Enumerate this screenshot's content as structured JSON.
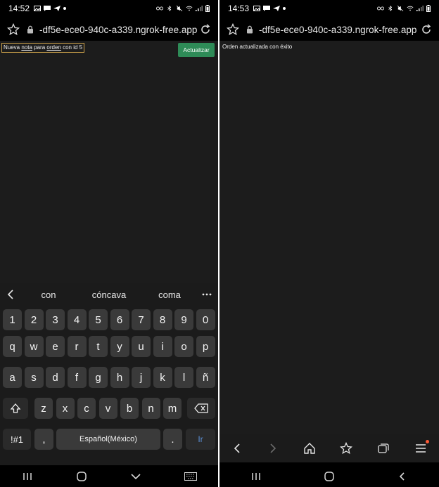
{
  "left": {
    "status": {
      "time": "14:52"
    },
    "url": "-df5e-ece0-940c-a339.ngrok-free.app",
    "note_input": {
      "text_parts": [
        "Nueva ",
        "nota",
        " para ",
        "orden",
        " con id 5"
      ]
    },
    "update_button": "Actualizar",
    "keyboard": {
      "suggestions": [
        "con",
        "cóncava",
        "coma"
      ],
      "row_numbers": [
        "1",
        "2",
        "3",
        "4",
        "5",
        "6",
        "7",
        "8",
        "9",
        "0"
      ],
      "row1": [
        "q",
        "w",
        "e",
        "r",
        "t",
        "y",
        "u",
        "i",
        "o",
        "p"
      ],
      "row2": [
        "a",
        "s",
        "d",
        "f",
        "g",
        "h",
        "j",
        "k",
        "l",
        "ñ"
      ],
      "row3": [
        "z",
        "x",
        "c",
        "v",
        "b",
        "n",
        "m"
      ],
      "symbols_key": "!#1",
      "comma_key": ",",
      "space_label": "Español(México)",
      "period_key": ".",
      "go_key": "Ir"
    }
  },
  "right": {
    "status": {
      "time": "14:53"
    },
    "url": "-df5e-ece0-940c-a339.ngrok-free.app",
    "message": "Orden actualizada con éxito"
  }
}
